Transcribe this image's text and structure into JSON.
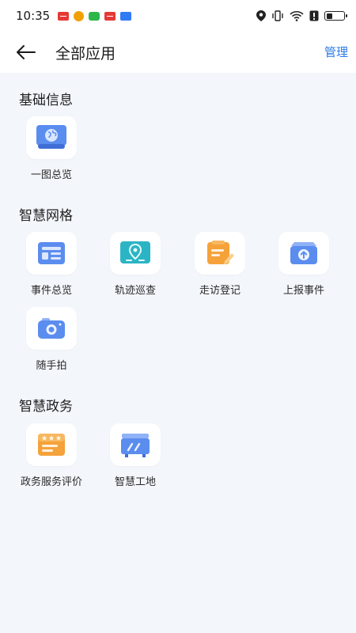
{
  "status_bar": {
    "time": "10:35",
    "notification_icons": [
      "red-app-icon",
      "weibo-icon",
      "wechat-icon",
      "red-app-icon",
      "blue-upload-icon"
    ],
    "system_icons": [
      "location-icon",
      "vibrate-icon",
      "wifi-icon",
      "alert-icon",
      "battery-icon"
    ],
    "battery_level": 0.35
  },
  "header": {
    "back_icon": "arrow-left-icon",
    "title": "全部应用",
    "manage_label": "管理"
  },
  "sections": [
    {
      "title": "基础信息",
      "apps": [
        {
          "label": "一图总览",
          "icon": "globe-monitor-icon"
        }
      ]
    },
    {
      "title": "智慧网格",
      "apps": [
        {
          "label": "事件总览",
          "icon": "list-card-icon"
        },
        {
          "label": "轨迹巡查",
          "icon": "map-pin-route-icon"
        },
        {
          "label": "走访登记",
          "icon": "notepad-pen-icon"
        },
        {
          "label": "上报事件",
          "icon": "upload-tray-icon"
        },
        {
          "label": "随手拍",
          "icon": "camera-icon"
        }
      ]
    },
    {
      "title": "智慧政务",
      "apps": [
        {
          "label": "政务服务评价",
          "icon": "star-rating-card-icon"
        },
        {
          "label": "智慧工地",
          "icon": "construction-board-icon"
        }
      ]
    }
  ],
  "colors": {
    "accent": "#2b7be6",
    "page_bg": "#f3f6fb",
    "icon_blue": "#5b8def",
    "icon_teal": "#2bb5c4",
    "icon_orange": "#f5a23a"
  }
}
